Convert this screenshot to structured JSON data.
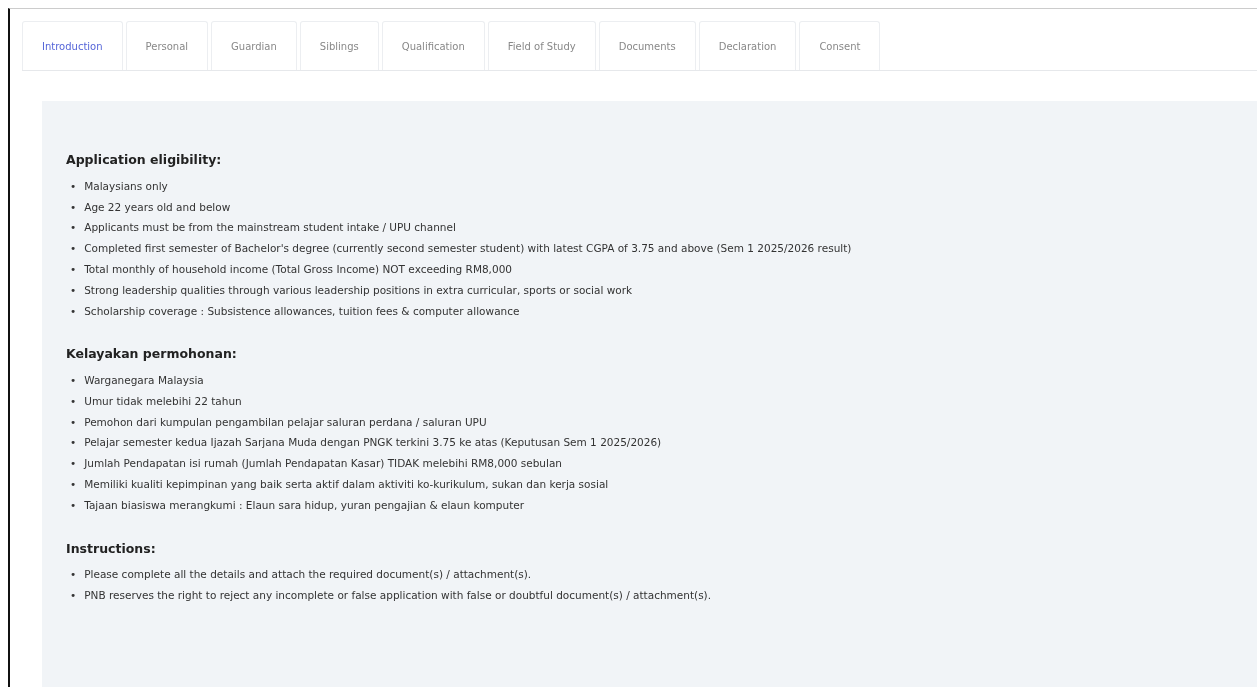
{
  "tabs": [
    {
      "label": "Introduction",
      "selected": true
    },
    {
      "label": "Personal",
      "selected": false
    },
    {
      "label": "Guardian",
      "selected": false
    },
    {
      "label": "Siblings",
      "selected": false
    },
    {
      "label": "Qualification",
      "selected": false
    },
    {
      "label": "Field of Study",
      "selected": false
    },
    {
      "label": "Documents",
      "selected": false
    },
    {
      "label": "Declaration",
      "selected": false
    },
    {
      "label": "Consent",
      "selected": false
    }
  ],
  "bullet": "•",
  "sections": [
    {
      "heading": "Application eligibility:",
      "items": [
        "Malaysians only",
        "Age 22 years old and below",
        "Applicants must be from the mainstream student intake / UPU channel",
        "Completed first semester of Bachelor's degree (currently second semester student) with latest CGPA of 3.75 and above (Sem 1 2025/2026 result)",
        "Total monthly of household income (Total Gross Income) NOT exceeding RM8,000",
        "Strong leadership qualities through various leadership positions in extra curricular, sports or social work",
        "Scholarship coverage : Subsistence allowances, tuition fees & computer allowance"
      ]
    },
    {
      "heading": "Kelayakan permohonan:",
      "items": [
        "Warganegara Malaysia",
        "Umur tidak melebihi 22 tahun",
        "Pemohon dari kumpulan pengambilan pelajar saluran perdana / saluran UPU",
        "Pelajar semester kedua Ijazah Sarjana Muda dengan PNGK terkini 3.75 ke atas (Keputusan Sem 1 2025/2026)",
        "Jumlah Pendapatan isi rumah (Jumlah Pendapatan Kasar) TIDAK melebihi RM8,000 sebulan",
        "Memiliki kualiti kepimpinan yang baik serta aktif dalam aktiviti ko-kurikulum, sukan dan kerja sosial",
        "Tajaan biasiswa merangkumi : Elaun sara hidup, yuran pengajian & elaun komputer"
      ]
    },
    {
      "heading": "Instructions:",
      "items": [
        "Please complete all the details and attach the required document(s) / attachment(s).",
        "PNB reserves the right to reject any incomplete or false application with false or doubtful document(s) / attachment(s)."
      ]
    }
  ]
}
